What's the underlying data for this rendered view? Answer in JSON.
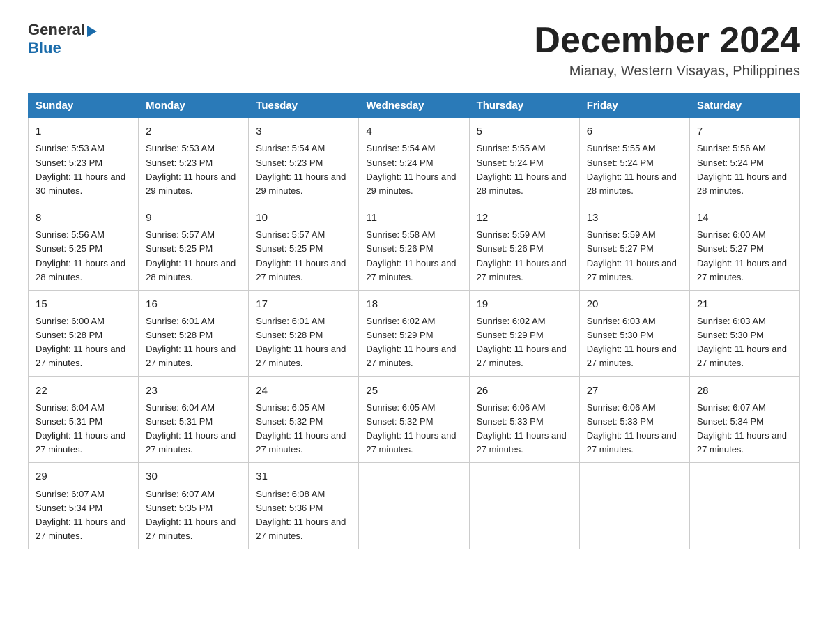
{
  "header": {
    "logo_general": "General",
    "logo_blue": "Blue",
    "month_year": "December 2024",
    "location": "Mianay, Western Visayas, Philippines"
  },
  "days_of_week": [
    "Sunday",
    "Monday",
    "Tuesday",
    "Wednesday",
    "Thursday",
    "Friday",
    "Saturday"
  ],
  "weeks": [
    [
      {
        "day": "1",
        "sunrise": "5:53 AM",
        "sunset": "5:23 PM",
        "daylight": "11 hours and 30 minutes."
      },
      {
        "day": "2",
        "sunrise": "5:53 AM",
        "sunset": "5:23 PM",
        "daylight": "11 hours and 29 minutes."
      },
      {
        "day": "3",
        "sunrise": "5:54 AM",
        "sunset": "5:23 PM",
        "daylight": "11 hours and 29 minutes."
      },
      {
        "day": "4",
        "sunrise": "5:54 AM",
        "sunset": "5:24 PM",
        "daylight": "11 hours and 29 minutes."
      },
      {
        "day": "5",
        "sunrise": "5:55 AM",
        "sunset": "5:24 PM",
        "daylight": "11 hours and 28 minutes."
      },
      {
        "day": "6",
        "sunrise": "5:55 AM",
        "sunset": "5:24 PM",
        "daylight": "11 hours and 28 minutes."
      },
      {
        "day": "7",
        "sunrise": "5:56 AM",
        "sunset": "5:24 PM",
        "daylight": "11 hours and 28 minutes."
      }
    ],
    [
      {
        "day": "8",
        "sunrise": "5:56 AM",
        "sunset": "5:25 PM",
        "daylight": "11 hours and 28 minutes."
      },
      {
        "day": "9",
        "sunrise": "5:57 AM",
        "sunset": "5:25 PM",
        "daylight": "11 hours and 28 minutes."
      },
      {
        "day": "10",
        "sunrise": "5:57 AM",
        "sunset": "5:25 PM",
        "daylight": "11 hours and 27 minutes."
      },
      {
        "day": "11",
        "sunrise": "5:58 AM",
        "sunset": "5:26 PM",
        "daylight": "11 hours and 27 minutes."
      },
      {
        "day": "12",
        "sunrise": "5:59 AM",
        "sunset": "5:26 PM",
        "daylight": "11 hours and 27 minutes."
      },
      {
        "day": "13",
        "sunrise": "5:59 AM",
        "sunset": "5:27 PM",
        "daylight": "11 hours and 27 minutes."
      },
      {
        "day": "14",
        "sunrise": "6:00 AM",
        "sunset": "5:27 PM",
        "daylight": "11 hours and 27 minutes."
      }
    ],
    [
      {
        "day": "15",
        "sunrise": "6:00 AM",
        "sunset": "5:28 PM",
        "daylight": "11 hours and 27 minutes."
      },
      {
        "day": "16",
        "sunrise": "6:01 AM",
        "sunset": "5:28 PM",
        "daylight": "11 hours and 27 minutes."
      },
      {
        "day": "17",
        "sunrise": "6:01 AM",
        "sunset": "5:28 PM",
        "daylight": "11 hours and 27 minutes."
      },
      {
        "day": "18",
        "sunrise": "6:02 AM",
        "sunset": "5:29 PM",
        "daylight": "11 hours and 27 minutes."
      },
      {
        "day": "19",
        "sunrise": "6:02 AM",
        "sunset": "5:29 PM",
        "daylight": "11 hours and 27 minutes."
      },
      {
        "day": "20",
        "sunrise": "6:03 AM",
        "sunset": "5:30 PM",
        "daylight": "11 hours and 27 minutes."
      },
      {
        "day": "21",
        "sunrise": "6:03 AM",
        "sunset": "5:30 PM",
        "daylight": "11 hours and 27 minutes."
      }
    ],
    [
      {
        "day": "22",
        "sunrise": "6:04 AM",
        "sunset": "5:31 PM",
        "daylight": "11 hours and 27 minutes."
      },
      {
        "day": "23",
        "sunrise": "6:04 AM",
        "sunset": "5:31 PM",
        "daylight": "11 hours and 27 minutes."
      },
      {
        "day": "24",
        "sunrise": "6:05 AM",
        "sunset": "5:32 PM",
        "daylight": "11 hours and 27 minutes."
      },
      {
        "day": "25",
        "sunrise": "6:05 AM",
        "sunset": "5:32 PM",
        "daylight": "11 hours and 27 minutes."
      },
      {
        "day": "26",
        "sunrise": "6:06 AM",
        "sunset": "5:33 PM",
        "daylight": "11 hours and 27 minutes."
      },
      {
        "day": "27",
        "sunrise": "6:06 AM",
        "sunset": "5:33 PM",
        "daylight": "11 hours and 27 minutes."
      },
      {
        "day": "28",
        "sunrise": "6:07 AM",
        "sunset": "5:34 PM",
        "daylight": "11 hours and 27 minutes."
      }
    ],
    [
      {
        "day": "29",
        "sunrise": "6:07 AM",
        "sunset": "5:34 PM",
        "daylight": "11 hours and 27 minutes."
      },
      {
        "day": "30",
        "sunrise": "6:07 AM",
        "sunset": "5:35 PM",
        "daylight": "11 hours and 27 minutes."
      },
      {
        "day": "31",
        "sunrise": "6:08 AM",
        "sunset": "5:36 PM",
        "daylight": "11 hours and 27 minutes."
      },
      null,
      null,
      null,
      null
    ]
  ],
  "labels": {
    "sunrise": "Sunrise:",
    "sunset": "Sunset:",
    "daylight": "Daylight:"
  }
}
